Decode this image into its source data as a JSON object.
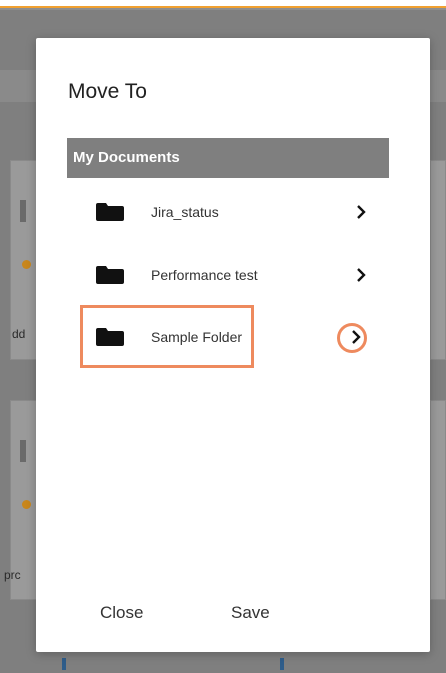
{
  "dialog": {
    "title": "Move To",
    "root_folder": "My Documents",
    "folders": [
      {
        "name": "Jira_status",
        "icon": "folder-icon",
        "expand_icon": "chevron-right-icon"
      },
      {
        "name": "Performance test",
        "icon": "folder-icon",
        "expand_icon": "chevron-right-icon"
      },
      {
        "name": "Sample Folder",
        "icon": "folder-icon",
        "expand_icon": "chevron-right-icon",
        "highlighted": true
      }
    ],
    "close_label": "Close",
    "save_label": "Save"
  },
  "background": {
    "truncated_labels": [
      "dd",
      "prc"
    ]
  },
  "colors": {
    "header_bg": "#7f7f7f",
    "highlight": "#ee8a5e",
    "accent_top": "#f0a030",
    "overlay": "#8e8e8e"
  }
}
